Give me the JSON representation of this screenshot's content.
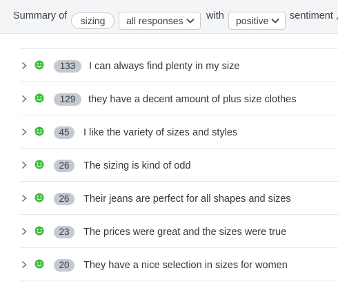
{
  "header": {
    "summary_of": "Summary of",
    "topic_tag": "sizing",
    "responses_dropdown": "all responses",
    "with": "with",
    "sentiment_dropdown": "positive",
    "sentiment_suffix": "sentiment ,"
  },
  "colors": {
    "toolbar_bg": "#f4f5f7",
    "count_badge_bg": "#c5cad0",
    "positive_sentiment": "#3cbf3c"
  },
  "rows": [
    {
      "sentiment": "positive",
      "count": "133",
      "text": "I can always find plenty in my size"
    },
    {
      "sentiment": "positive",
      "count": "129",
      "text": "they have a decent amount of plus size clothes"
    },
    {
      "sentiment": "positive",
      "count": "45",
      "text": "I like the variety of sizes and styles"
    },
    {
      "sentiment": "positive",
      "count": "26",
      "text": "The sizing is kind of odd"
    },
    {
      "sentiment": "positive",
      "count": "26",
      "text": "Their jeans are perfect for all shapes and sizes"
    },
    {
      "sentiment": "positive",
      "count": "23",
      "text": "The prices were great and the sizes were true"
    },
    {
      "sentiment": "positive",
      "count": "20",
      "text": "They have a nice selection in sizes for women"
    }
  ]
}
